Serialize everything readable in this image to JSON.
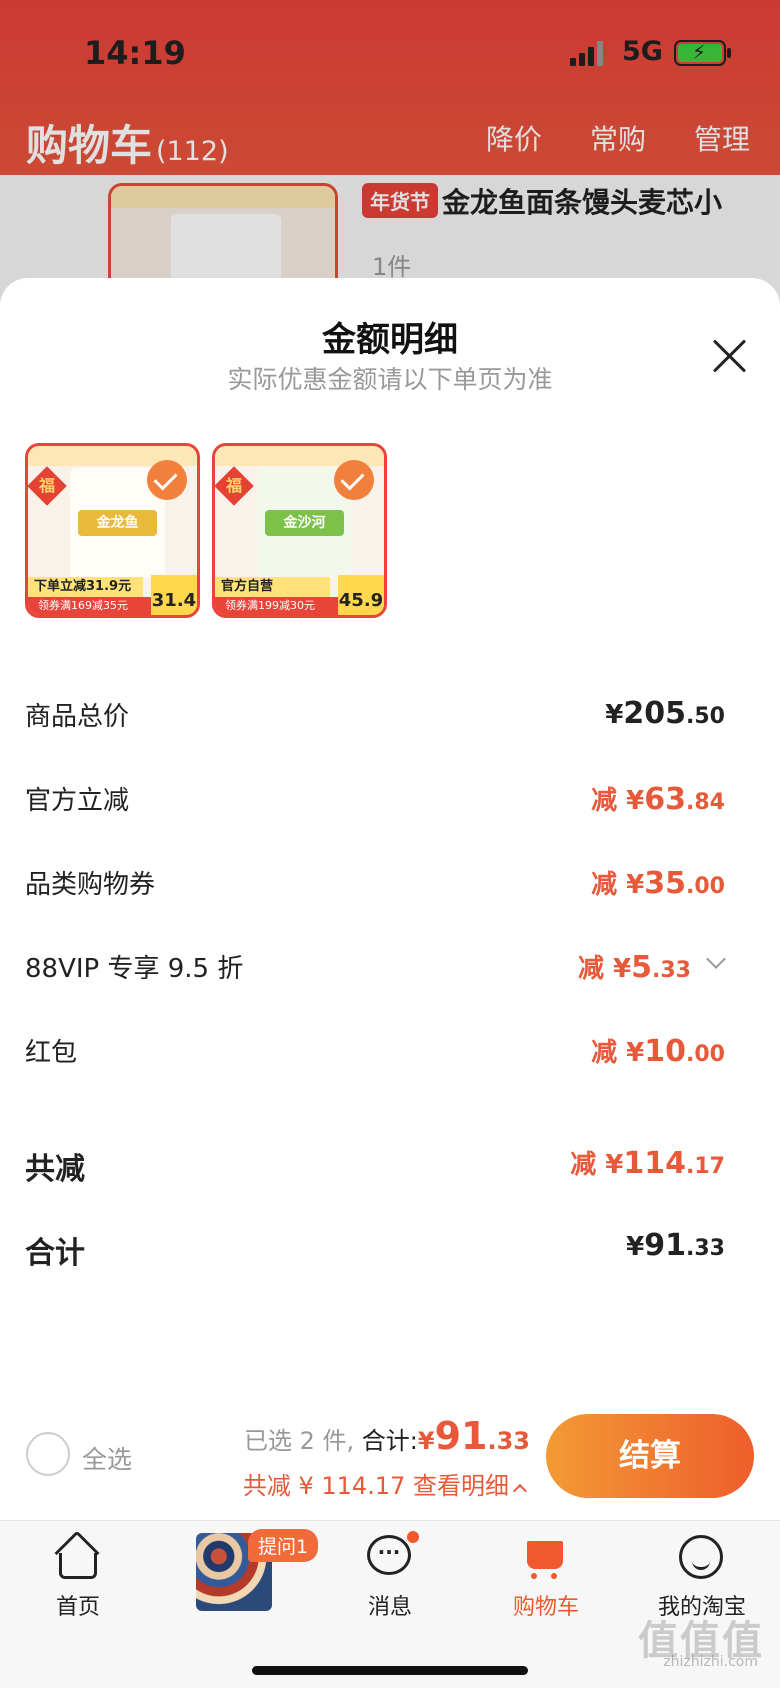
{
  "status_bar": {
    "time": "14:19",
    "network": "5G"
  },
  "header": {
    "title": "购物车",
    "count": "(112)",
    "actions": [
      "降价",
      "常购",
      "管理"
    ]
  },
  "background_item": {
    "tag": "年货节",
    "name": "金龙鱼面条馒头麦芯小",
    "qty": "1件"
  },
  "sheet": {
    "title": "金额明细",
    "subtitle": "实际优惠金额请以下单页为准",
    "products": [
      {
        "brand": "金龙鱼",
        "promo": "下单立减31.9元",
        "coupon": "领券满169减35元",
        "price": "31.4",
        "pkg_color": "#e9b93a"
      },
      {
        "brand": "金沙河",
        "promo": "官方自营",
        "coupon": "领券满199减30元",
        "price": "45.9",
        "pkg_color": "#7cc24a"
      }
    ],
    "breakdown": [
      {
        "label": "商品总价",
        "prefix": "",
        "symbol": "¥",
        "int": "205",
        "dec": ".50",
        "color": "dark"
      },
      {
        "label": "官方立减",
        "prefix": "减 ",
        "symbol": "¥",
        "int": "63",
        "dec": ".84",
        "color": "red"
      },
      {
        "label": "品类购物券",
        "prefix": "减 ",
        "symbol": "¥",
        "int": "35",
        "dec": ".00",
        "color": "red"
      },
      {
        "label": "88VIP 专享 9.5 折",
        "prefix": "减 ",
        "symbol": "¥",
        "int": "5",
        "dec": ".33",
        "color": "red"
      },
      {
        "label": "红包",
        "prefix": "减 ",
        "symbol": "¥",
        "int": "10",
        "dec": ".00",
        "color": "red"
      }
    ],
    "total_reduce": {
      "label": "共减",
      "prefix": "减 ",
      "symbol": "¥",
      "int": "114",
      "dec": ".17"
    },
    "total": {
      "label": "合计",
      "symbol": "¥",
      "int": "91",
      "dec": ".33"
    }
  },
  "checkout": {
    "select_all": "全选",
    "selected": "已选 2 件,",
    "sum_label": "合计:",
    "currency": "¥",
    "sum_int": "91",
    "sum_dec": ".33",
    "detail": "共减 ¥ 114.17  查看明细",
    "pay_label": "结算"
  },
  "tabbar": {
    "tabs": [
      "首页",
      "提问1",
      "消息",
      "购物车",
      "我的淘宝"
    ],
    "active": "购物车"
  },
  "watermark": {
    "main": "值值值",
    "sub": "zhizhizhi.com"
  },
  "colors": {
    "accent": "#e8593a",
    "header": "#e9413a",
    "pay_start": "#f39a35",
    "pay_end": "#ee5e2c"
  }
}
